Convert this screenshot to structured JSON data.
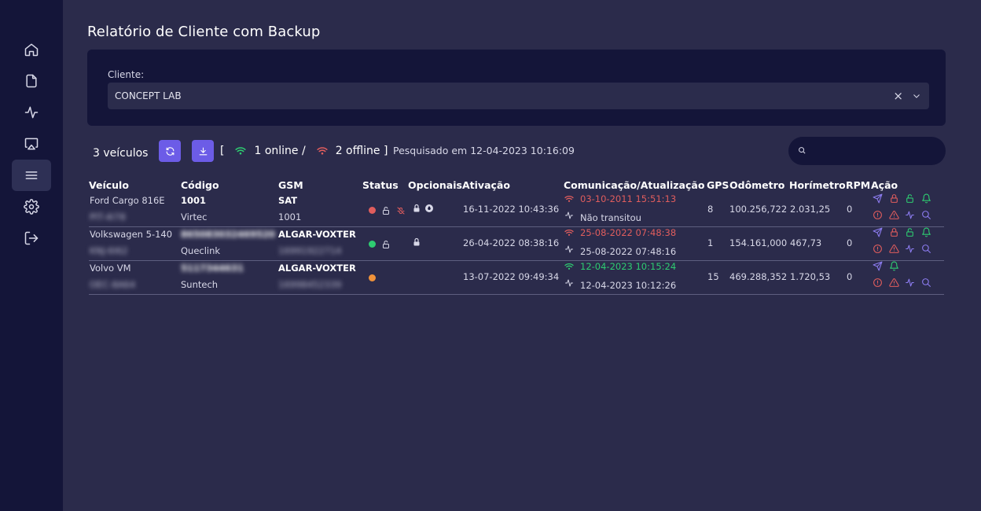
{
  "page": {
    "title": "Relatório de Cliente com Backup"
  },
  "sidebar": {
    "items": [
      {
        "icon": "home-icon"
      },
      {
        "icon": "document-icon"
      },
      {
        "icon": "activity-icon"
      },
      {
        "icon": "monitor-icon"
      },
      {
        "icon": "menu-icon",
        "active": true
      },
      {
        "icon": "gear-icon"
      },
      {
        "icon": "logout-icon"
      }
    ]
  },
  "filter": {
    "label": "Cliente:",
    "selected": "CONCEPT LAB",
    "clear": "×"
  },
  "toolbar": {
    "count_label": "3 veículos",
    "bracket_open": "[",
    "online_label": "1 online /",
    "offline_label": "2 offline ]",
    "searched_label": "Pesquisado em 12-04-2023 10:16:09",
    "search_placeholder": ""
  },
  "colors": {
    "accent": "#6c5ce7",
    "online": "#2ecc71",
    "offline": "#e05d5d",
    "warning": "#f0923a"
  },
  "table": {
    "headers": {
      "veiculo": "Veículo",
      "codigo": "Código",
      "gsm": "GSM",
      "status": "Status",
      "opcionais": "Opcionais",
      "ativacao": "Ativação",
      "comunicacao": "Comunicação/Atualização",
      "gps": "GPS",
      "odometro": "Odômetro",
      "horimetro": "Horímetro",
      "rpm": "RPM",
      "acao": "Ação"
    },
    "rows": [
      {
        "vehicle": "Ford Cargo 816E",
        "plate": "PIT-4I78",
        "code": "1001",
        "brand": "Virtec",
        "gsm": "SAT",
        "gsm_number": "1001",
        "status_color": "#e05d5d",
        "activation": "16-11-2022 10:43:36",
        "comm": "03-10-2011 15:51:13",
        "comm_color": "#e05d5d",
        "update": "Não transitou",
        "gps": "8",
        "odometer": "100.256,722",
        "hourmeter": "2.031,25",
        "rpm": "0"
      },
      {
        "vehicle": "Volkswagen 5-140",
        "plate": "KNJ-6I62",
        "code": "865083032469520",
        "brand": "Queclink",
        "gsm": "ALGAR-VOXTER",
        "gsm_number": "16991922714",
        "status_color": "#2ecc71",
        "activation": "26-04-2022 08:38:16",
        "comm": "25-08-2022 07:48:38",
        "comm_color": "#e05d5d",
        "update": "25-08-2022 07:48:16",
        "gps": "1",
        "odometer": "154.161,000",
        "hourmeter": "467,73",
        "rpm": "0"
      },
      {
        "vehicle": "Volvo VM",
        "plate": "OEC-8A64",
        "code": "5117344631",
        "brand": "Suntech",
        "gsm": "ALGAR-VOXTER",
        "gsm_number": "16998452339",
        "status_color": "#f0923a",
        "activation": "13-07-2022 09:49:34",
        "comm": "12-04-2023 10:15:24",
        "comm_color": "#2ecc71",
        "update": "12-04-2023 10:12:26",
        "gps": "15",
        "odometer": "469.288,352",
        "hourmeter": "1.720,53",
        "rpm": "0"
      }
    ]
  }
}
